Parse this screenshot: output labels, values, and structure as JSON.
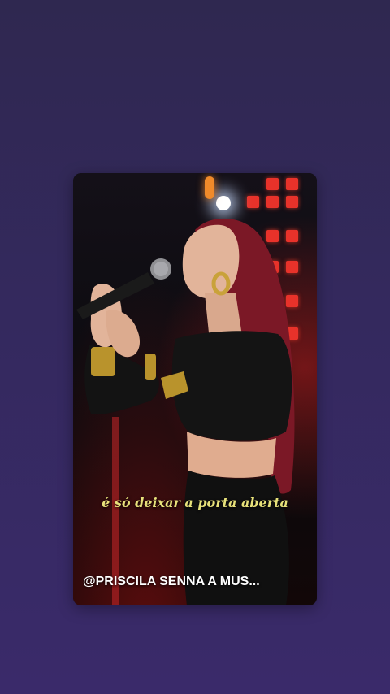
{
  "story": {
    "lyric_text": "é só deixar a porta aberta",
    "caption_text": "@PRISCILA SENNA A MUS..."
  },
  "colors": {
    "background": "#34295e",
    "lyric": "#e7e17a",
    "caption": "#ffffff",
    "stage_led": "#e8322a"
  }
}
